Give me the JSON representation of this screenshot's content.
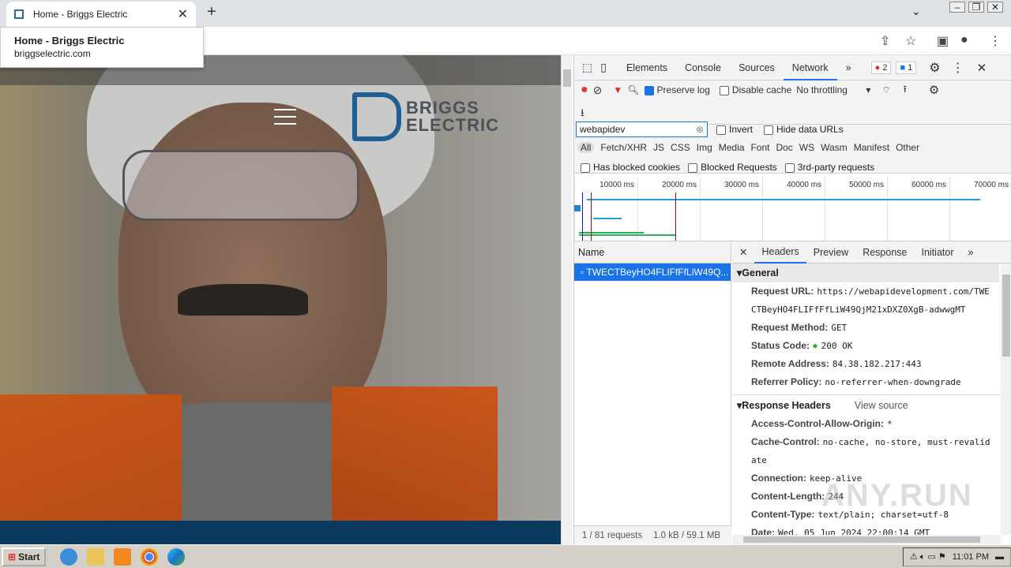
{
  "browser": {
    "tab_title": "Home - Briggs Electric",
    "close": "✕",
    "new_tab": "+",
    "win_min": "–",
    "win_max": "❐",
    "win_close": "✕",
    "chevron": "⌄"
  },
  "popup": {
    "title": "Home - Briggs Electric",
    "url": "briggselectric.com"
  },
  "site": {
    "logo_line1": "BRIGGS",
    "logo_line2": "ELECTRIC"
  },
  "devtools": {
    "tabs": [
      "Elements",
      "Console",
      "Sources",
      "Network",
      "»"
    ],
    "errors": "2",
    "messages": "1",
    "toolbar": {
      "preserve_log": "Preserve log",
      "disable_cache": "Disable cache",
      "throttling": "No throttling"
    },
    "filter": {
      "value": "webapidev",
      "invert": "Invert",
      "hide_data_urls": "Hide data URLs"
    },
    "types": [
      "All",
      "Fetch/XHR",
      "JS",
      "CSS",
      "Img",
      "Media",
      "Font",
      "Doc",
      "WS",
      "Wasm",
      "Manifest",
      "Other"
    ],
    "checks": [
      "Has blocked cookies",
      "Blocked Requests",
      "3rd-party requests"
    ],
    "timeline": [
      "10000 ms",
      "20000 ms",
      "30000 ms",
      "40000 ms",
      "50000 ms",
      "60000 ms",
      "70000 ms"
    ],
    "name_header": "Name",
    "request": "TWECTBeyHO4FLIFfFfLiW49Q...",
    "footer": {
      "requests": "1 / 81 requests",
      "size": "1.0 kB / 59.1 MB"
    },
    "detail_tabs": [
      "Headers",
      "Preview",
      "Response",
      "Initiator",
      "»"
    ],
    "general": {
      "title": "General",
      "rows": [
        {
          "k": "Request URL:",
          "v": "https://webapidevelopment.com/TWE"
        },
        {
          "k": "",
          "v": "CTBeyHO4FLIFfFfLiW49QjM21xDXZ0XgB-adwwgMT"
        },
        {
          "k": "Request Method:",
          "v": "GET"
        },
        {
          "k": "Status Code:",
          "v": "200 OK"
        },
        {
          "k": "Remote Address:",
          "v": "84.38.182.217:443"
        },
        {
          "k": "Referrer Policy:",
          "v": "no-referrer-when-downgrade"
        }
      ]
    },
    "response": {
      "title": "Response Headers",
      "view_source": "View source",
      "rows": [
        {
          "k": "Access-Control-Allow-Origin:",
          "v": "*"
        },
        {
          "k": "Cache-Control:",
          "v": "no-cache, no-store, must-revalid"
        },
        {
          "k": "",
          "v": "ate"
        },
        {
          "k": "Connection:",
          "v": "keep-alive"
        },
        {
          "k": "Content-Length:",
          "v": "244"
        },
        {
          "k": "Content-Type:",
          "v": "text/plain; charset=utf-8"
        },
        {
          "k": "Date:",
          "v": "Wed, 05 Jun 2024 22:00:14 GMT"
        }
      ]
    }
  },
  "taskbar": {
    "start": "Start",
    "time": "11:01 PM"
  },
  "watermark": "ANY.RUN"
}
